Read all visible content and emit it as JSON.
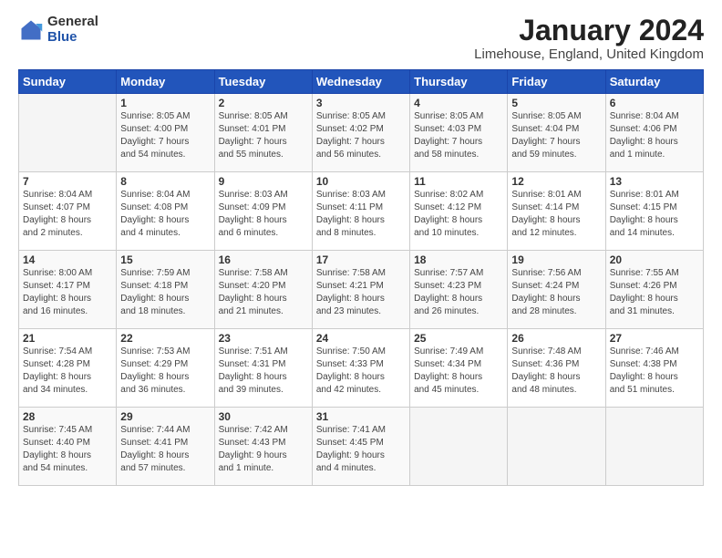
{
  "logo": {
    "general": "General",
    "blue": "Blue"
  },
  "title": "January 2024",
  "subtitle": "Limehouse, England, United Kingdom",
  "days_of_week": [
    "Sunday",
    "Monday",
    "Tuesday",
    "Wednesday",
    "Thursday",
    "Friday",
    "Saturday"
  ],
  "weeks": [
    [
      {
        "day": "",
        "info": ""
      },
      {
        "day": "1",
        "info": "Sunrise: 8:05 AM\nSunset: 4:00 PM\nDaylight: 7 hours\nand 54 minutes."
      },
      {
        "day": "2",
        "info": "Sunrise: 8:05 AM\nSunset: 4:01 PM\nDaylight: 7 hours\nand 55 minutes."
      },
      {
        "day": "3",
        "info": "Sunrise: 8:05 AM\nSunset: 4:02 PM\nDaylight: 7 hours\nand 56 minutes."
      },
      {
        "day": "4",
        "info": "Sunrise: 8:05 AM\nSunset: 4:03 PM\nDaylight: 7 hours\nand 58 minutes."
      },
      {
        "day": "5",
        "info": "Sunrise: 8:05 AM\nSunset: 4:04 PM\nDaylight: 7 hours\nand 59 minutes."
      },
      {
        "day": "6",
        "info": "Sunrise: 8:04 AM\nSunset: 4:06 PM\nDaylight: 8 hours\nand 1 minute."
      }
    ],
    [
      {
        "day": "7",
        "info": "Sunrise: 8:04 AM\nSunset: 4:07 PM\nDaylight: 8 hours\nand 2 minutes."
      },
      {
        "day": "8",
        "info": "Sunrise: 8:04 AM\nSunset: 4:08 PM\nDaylight: 8 hours\nand 4 minutes."
      },
      {
        "day": "9",
        "info": "Sunrise: 8:03 AM\nSunset: 4:09 PM\nDaylight: 8 hours\nand 6 minutes."
      },
      {
        "day": "10",
        "info": "Sunrise: 8:03 AM\nSunset: 4:11 PM\nDaylight: 8 hours\nand 8 minutes."
      },
      {
        "day": "11",
        "info": "Sunrise: 8:02 AM\nSunset: 4:12 PM\nDaylight: 8 hours\nand 10 minutes."
      },
      {
        "day": "12",
        "info": "Sunrise: 8:01 AM\nSunset: 4:14 PM\nDaylight: 8 hours\nand 12 minutes."
      },
      {
        "day": "13",
        "info": "Sunrise: 8:01 AM\nSunset: 4:15 PM\nDaylight: 8 hours\nand 14 minutes."
      }
    ],
    [
      {
        "day": "14",
        "info": "Sunrise: 8:00 AM\nSunset: 4:17 PM\nDaylight: 8 hours\nand 16 minutes."
      },
      {
        "day": "15",
        "info": "Sunrise: 7:59 AM\nSunset: 4:18 PM\nDaylight: 8 hours\nand 18 minutes."
      },
      {
        "day": "16",
        "info": "Sunrise: 7:58 AM\nSunset: 4:20 PM\nDaylight: 8 hours\nand 21 minutes."
      },
      {
        "day": "17",
        "info": "Sunrise: 7:58 AM\nSunset: 4:21 PM\nDaylight: 8 hours\nand 23 minutes."
      },
      {
        "day": "18",
        "info": "Sunrise: 7:57 AM\nSunset: 4:23 PM\nDaylight: 8 hours\nand 26 minutes."
      },
      {
        "day": "19",
        "info": "Sunrise: 7:56 AM\nSunset: 4:24 PM\nDaylight: 8 hours\nand 28 minutes."
      },
      {
        "day": "20",
        "info": "Sunrise: 7:55 AM\nSunset: 4:26 PM\nDaylight: 8 hours\nand 31 minutes."
      }
    ],
    [
      {
        "day": "21",
        "info": "Sunrise: 7:54 AM\nSunset: 4:28 PM\nDaylight: 8 hours\nand 34 minutes."
      },
      {
        "day": "22",
        "info": "Sunrise: 7:53 AM\nSunset: 4:29 PM\nDaylight: 8 hours\nand 36 minutes."
      },
      {
        "day": "23",
        "info": "Sunrise: 7:51 AM\nSunset: 4:31 PM\nDaylight: 8 hours\nand 39 minutes."
      },
      {
        "day": "24",
        "info": "Sunrise: 7:50 AM\nSunset: 4:33 PM\nDaylight: 8 hours\nand 42 minutes."
      },
      {
        "day": "25",
        "info": "Sunrise: 7:49 AM\nSunset: 4:34 PM\nDaylight: 8 hours\nand 45 minutes."
      },
      {
        "day": "26",
        "info": "Sunrise: 7:48 AM\nSunset: 4:36 PM\nDaylight: 8 hours\nand 48 minutes."
      },
      {
        "day": "27",
        "info": "Sunrise: 7:46 AM\nSunset: 4:38 PM\nDaylight: 8 hours\nand 51 minutes."
      }
    ],
    [
      {
        "day": "28",
        "info": "Sunrise: 7:45 AM\nSunset: 4:40 PM\nDaylight: 8 hours\nand 54 minutes."
      },
      {
        "day": "29",
        "info": "Sunrise: 7:44 AM\nSunset: 4:41 PM\nDaylight: 8 hours\nand 57 minutes."
      },
      {
        "day": "30",
        "info": "Sunrise: 7:42 AM\nSunset: 4:43 PM\nDaylight: 9 hours\nand 1 minute."
      },
      {
        "day": "31",
        "info": "Sunrise: 7:41 AM\nSunset: 4:45 PM\nDaylight: 9 hours\nand 4 minutes."
      },
      {
        "day": "",
        "info": ""
      },
      {
        "day": "",
        "info": ""
      },
      {
        "day": "",
        "info": ""
      }
    ]
  ]
}
